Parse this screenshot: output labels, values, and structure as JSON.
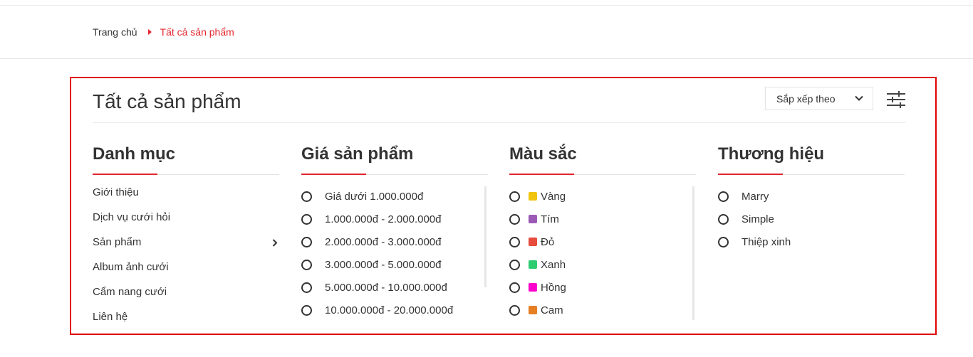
{
  "breadcrumb": {
    "home": "Trang chủ",
    "current": "Tất cả sản phẩm"
  },
  "page": {
    "title": "Tất cả sản phẩm",
    "sort_label": "Sắp xếp theo"
  },
  "categories": {
    "title": "Danh mục",
    "items": [
      {
        "label": "Giới thiệu"
      },
      {
        "label": "Dịch vụ cưới hỏi"
      },
      {
        "label": "Sản phẩm",
        "has_children": true
      },
      {
        "label": "Album ảnh cưới"
      },
      {
        "label": "Cẩm nang cưới"
      },
      {
        "label": "Liên hệ"
      }
    ]
  },
  "price": {
    "title": "Giá sản phẩm",
    "options": [
      "Giá dưới 1.000.000đ",
      "1.000.000đ - 2.000.000đ",
      "2.000.000đ - 3.000.000đ",
      "3.000.000đ - 5.000.000đ",
      "5.000.000đ - 10.000.000đ",
      "10.000.000đ - 20.000.000đ"
    ]
  },
  "color": {
    "title": "Màu sắc",
    "options": [
      {
        "label": "Vàng",
        "swatch": "#f1c40f"
      },
      {
        "label": "Tím",
        "swatch": "#9b59b6"
      },
      {
        "label": "Đỏ",
        "swatch": "#e74c3c"
      },
      {
        "label": "Xanh",
        "swatch": "#2ecc71"
      },
      {
        "label": "Hồng",
        "swatch": "#ff00cc"
      },
      {
        "label": "Cam",
        "swatch": "#e67e22"
      }
    ]
  },
  "brand": {
    "title": "Thương hiệu",
    "options": [
      "Marry",
      "Simple",
      "Thiệp xinh"
    ]
  },
  "colors": {
    "accent": "#e1262d",
    "panel_border": "#e00000"
  }
}
